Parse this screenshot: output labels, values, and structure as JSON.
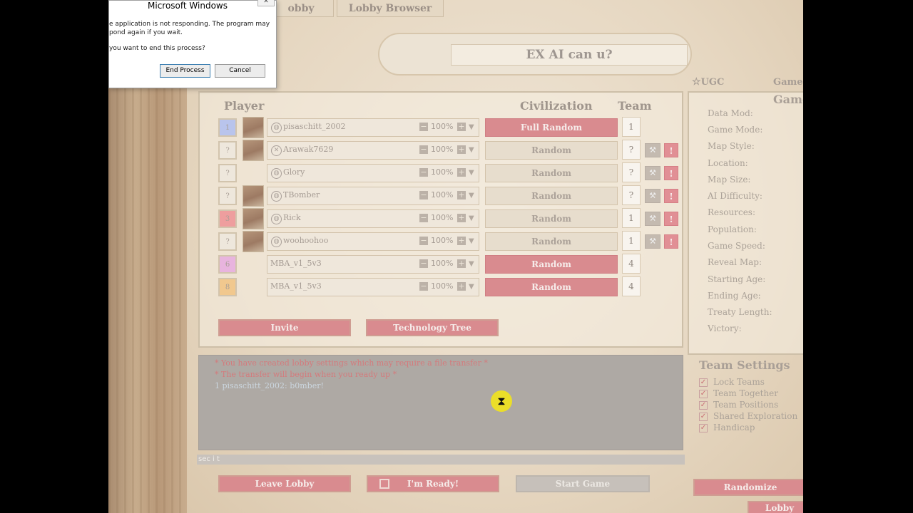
{
  "dialog": {
    "title": "Microsoft Windows",
    "close": "✕",
    "line1": "e application is not responding. The program may",
    "line2": "pond again if you wait.",
    "line3": "you want to end this process?",
    "end_process": "End Process",
    "cancel": "Cancel"
  },
  "tabs": {
    "lobby": "obby",
    "browser": "Lobby Browser"
  },
  "lobby_title": "EX AI can u?",
  "ugc": "UGC",
  "game_label": "Game I",
  "headers": {
    "player": "Player",
    "civilization": "Civilization",
    "team": "Team"
  },
  "players": [
    {
      "slot": "1",
      "slot_color": "#b9c4ec",
      "name": "pisaschitt_2002",
      "platform": "globe",
      "pct": "100%",
      "civ": "Full Random",
      "civ_style": "red",
      "team": "1",
      "has_tools": false,
      "avatar": true
    },
    {
      "slot": "?",
      "slot_color": "#eee7dc",
      "name": "Arawak7629",
      "platform": "xbox",
      "pct": "100%",
      "civ": "Random",
      "civ_style": "plain",
      "team": "?",
      "has_tools": true,
      "avatar": true
    },
    {
      "slot": "?",
      "slot_color": "#eee7dc",
      "name": "Glory",
      "platform": "globe",
      "pct": "100%",
      "civ": "Random",
      "civ_style": "plain",
      "team": "?",
      "has_tools": true,
      "avatar": false
    },
    {
      "slot": "?",
      "slot_color": "#eee7dc",
      "name": "TBomber",
      "platform": "globe",
      "pct": "100%",
      "civ": "Random",
      "civ_style": "plain",
      "team": "?",
      "has_tools": true,
      "avatar": true
    },
    {
      "slot": "3",
      "slot_color": "#ee9e9e",
      "name": "Rick",
      "platform": "globe",
      "pct": "100%",
      "civ": "Random",
      "civ_style": "plain",
      "team": "1",
      "has_tools": true,
      "avatar": true
    },
    {
      "slot": "?",
      "slot_color": "#eee7dc",
      "name": "woohoohoo",
      "platform": "globe",
      "pct": "100%",
      "civ": "Random",
      "civ_style": "plain",
      "team": "1",
      "has_tools": true,
      "avatar": true
    },
    {
      "slot": "6",
      "slot_color": "#e8b4de",
      "name": "MBA_v1_5v3",
      "platform": "ai",
      "pct": "100%",
      "civ": "Random",
      "civ_style": "red",
      "team": "4",
      "has_tools": false,
      "avatar": false
    },
    {
      "slot": "8",
      "slot_color": "#f1c88e",
      "name": "MBA_v1_5v3",
      "platform": "ai",
      "pct": "100%",
      "civ": "Random",
      "civ_style": "red",
      "team": "4",
      "has_tools": false,
      "avatar": false
    }
  ],
  "buttons": {
    "invite": "Invite",
    "tech_tree": "Technology Tree",
    "leave": "Leave Lobby",
    "ready": "I'm Ready!",
    "start": "Start Game",
    "randomize": "Randomize",
    "lobby": "Lobby"
  },
  "chat": {
    "lines": [
      {
        "text": "* You have created lobby settings which may require a file transfer *",
        "kind": "sys"
      },
      {
        "text": "* The transfer will begin when you ready up *",
        "kind": "sys"
      },
      {
        "text": "1 pisaschitt_2002: b0mber!",
        "kind": "user"
      }
    ],
    "input_value": "sec i t"
  },
  "settings": {
    "title": "Game",
    "labels": [
      "Data Mod:",
      "Game Mode:",
      "Map Style:",
      "Location:",
      "Map Size:",
      "AI Difficulty:",
      "Resources:",
      "Population:",
      "Game Speed:",
      "Reveal Map:",
      "Starting Age:",
      "Ending Age:",
      "Treaty Length:",
      "Victory:"
    ]
  },
  "team_settings": {
    "title": "Team Settings",
    "items": [
      "Lock Teams",
      "Team Together",
      "Team Positions",
      "Shared Exploration",
      "Handicap"
    ]
  },
  "cursor_icon": "hourglass"
}
